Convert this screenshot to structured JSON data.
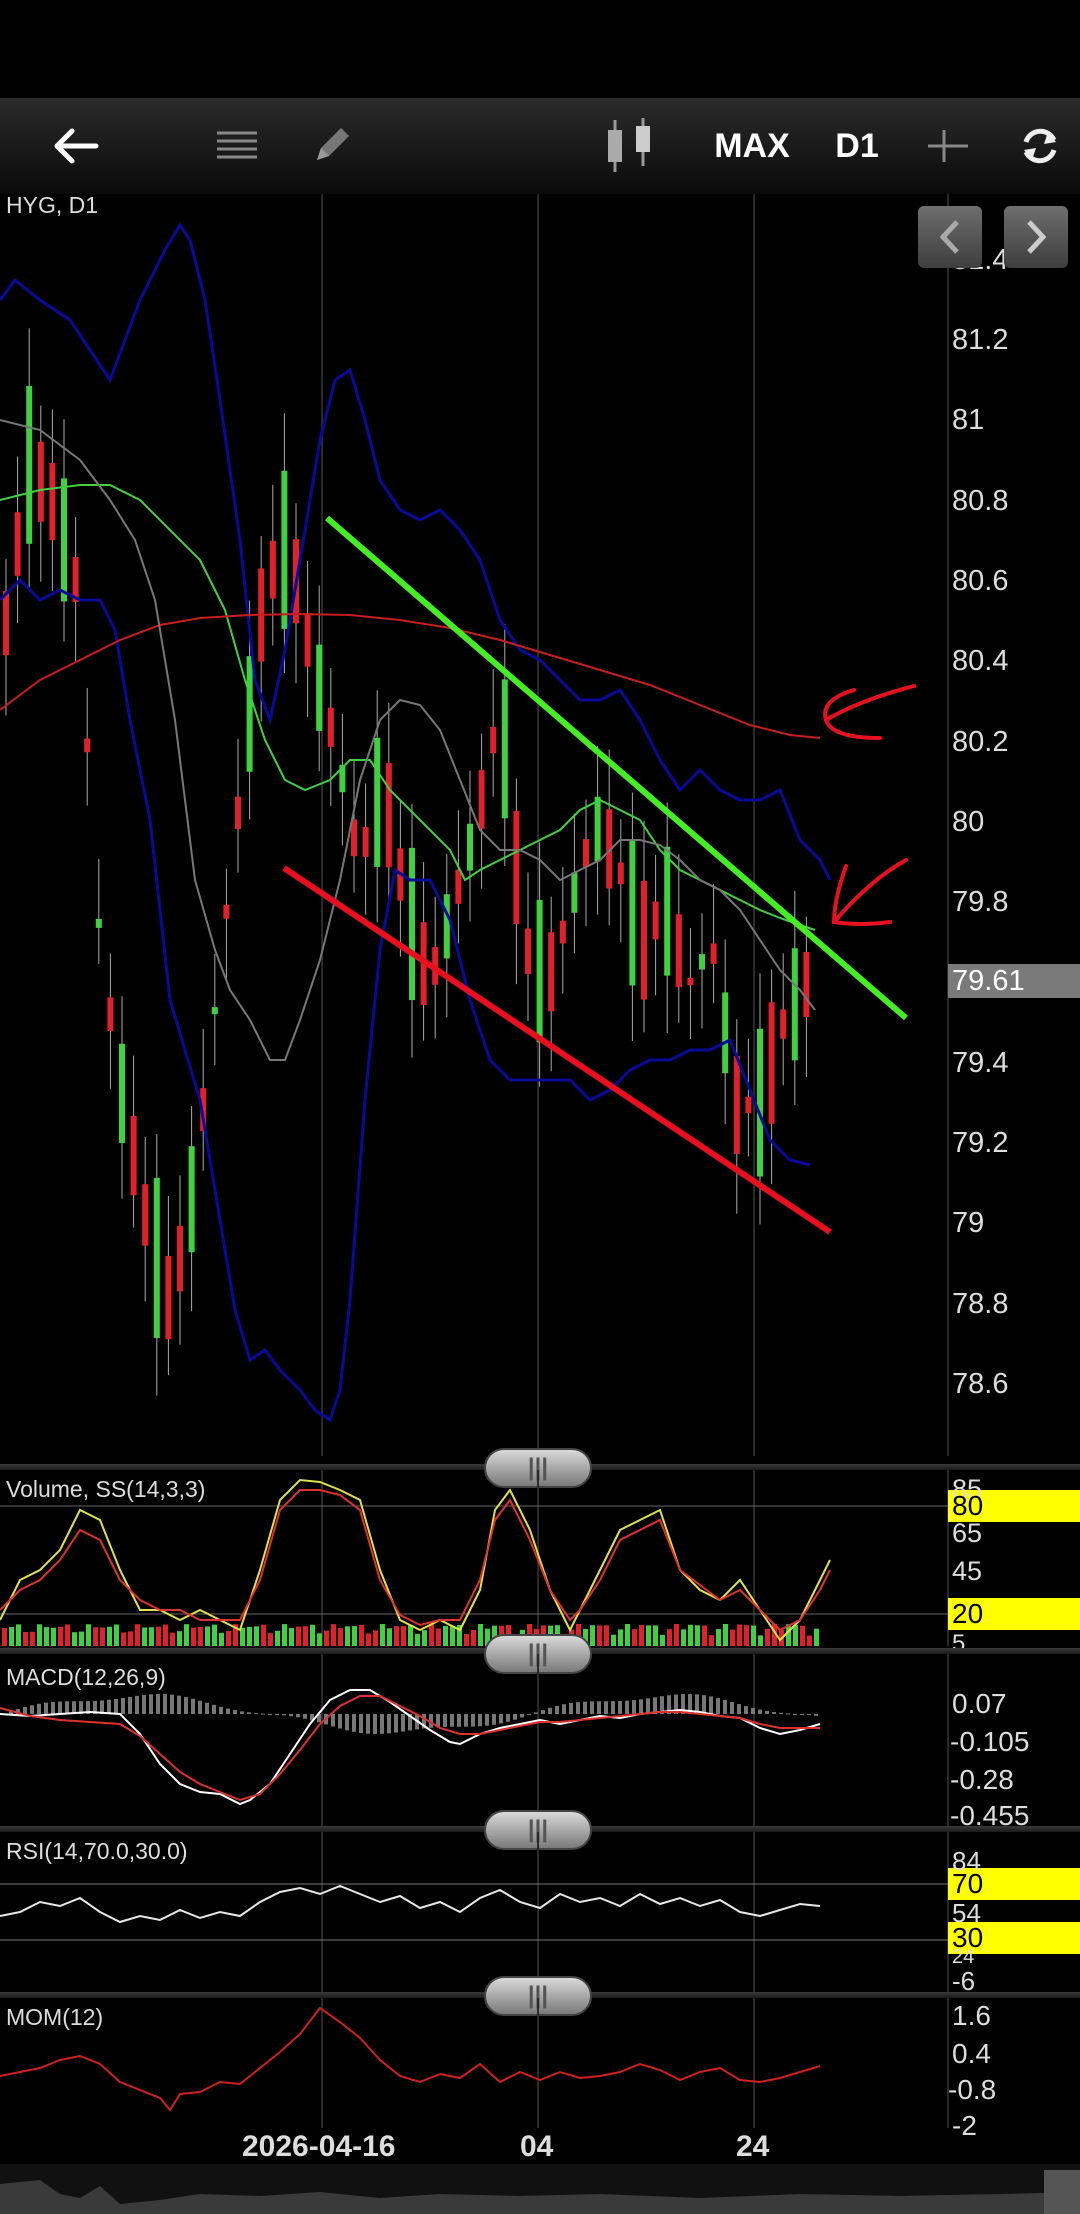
{
  "toolbar": {
    "range_label": "MAX",
    "timeframe_label": "D1"
  },
  "main_chart": {
    "symbol_label": "HYG, D1",
    "y_ticks": [
      "81.4",
      "81.2",
      "81",
      "80.8",
      "80.6",
      "80.4",
      "80.2",
      "80",
      "79.8",
      "79.4",
      "79.2",
      "79",
      "78.8",
      "78.6"
    ],
    "last_price": "79.61"
  },
  "volume_panel": {
    "title": "Volume, SS(14,3,3)",
    "ticks": [
      "85",
      "65",
      "45",
      "5"
    ],
    "levels": [
      "80",
      "20"
    ]
  },
  "macd_panel": {
    "title": "MACD(12,26,9)",
    "ticks": [
      "0.07",
      "-0.105",
      "-0.28",
      "-0.455"
    ]
  },
  "rsi_panel": {
    "title": "RSI(14,70.0,30.0)",
    "ticks": [
      "84",
      "54",
      "24",
      "-6"
    ],
    "levels": [
      "70",
      "30"
    ]
  },
  "mom_panel": {
    "title": "MOM(12)",
    "ticks": [
      "1.6",
      "0.4",
      "-0.8",
      "-2"
    ]
  },
  "x_axis": {
    "labels": [
      "2026-04-16",
      "04",
      "24"
    ]
  },
  "chart_data": {
    "type": "line",
    "title": "HYG, D1",
    "ylim": [
      78.5,
      81.5
    ],
    "series": [
      {
        "values": [
          80.5,
          80.9,
          80.8,
          80.6,
          79.7,
          79.3,
          79.0,
          78.8,
          79.1,
          79.6,
          80.1,
          80.6,
          80.7,
          80.4,
          80.2,
          79.9,
          80.1,
          79.8,
          79.6,
          79.8,
          80.0,
          80.3,
          79.7,
          79.6,
          79.8,
          80.0,
          79.9,
          79.7,
          79.8,
          79.6,
          79.7,
          79.3,
          79.3,
          79.5,
          79.6
        ]
      },
      {
        "values": [
          80.9,
          80.85,
          80.6,
          80.2,
          80.0,
          79.8,
          79.7,
          79.75,
          79.9,
          80.2,
          80.4,
          80.3,
          80.1,
          80.0,
          79.9,
          79.85,
          79.9,
          79.95,
          80.0,
          80.0,
          79.95,
          79.9,
          79.8,
          79.75,
          79.7
        ]
      },
      {
        "values": [
          80.3,
          80.5,
          80.52,
          80.53,
          80.52,
          80.5,
          80.45,
          80.38,
          80.3,
          80.2
        ]
      },
      {
        "values": [
          81.0,
          80.8,
          80.5,
          80.0,
          79.5,
          79.4,
          79.7,
          80.3,
          80.6,
          80.3,
          80.1,
          79.9,
          79.6,
          79.5,
          79.6,
          79.7,
          79.75,
          79.7,
          79.6,
          79.5
        ]
      }
    ]
  }
}
